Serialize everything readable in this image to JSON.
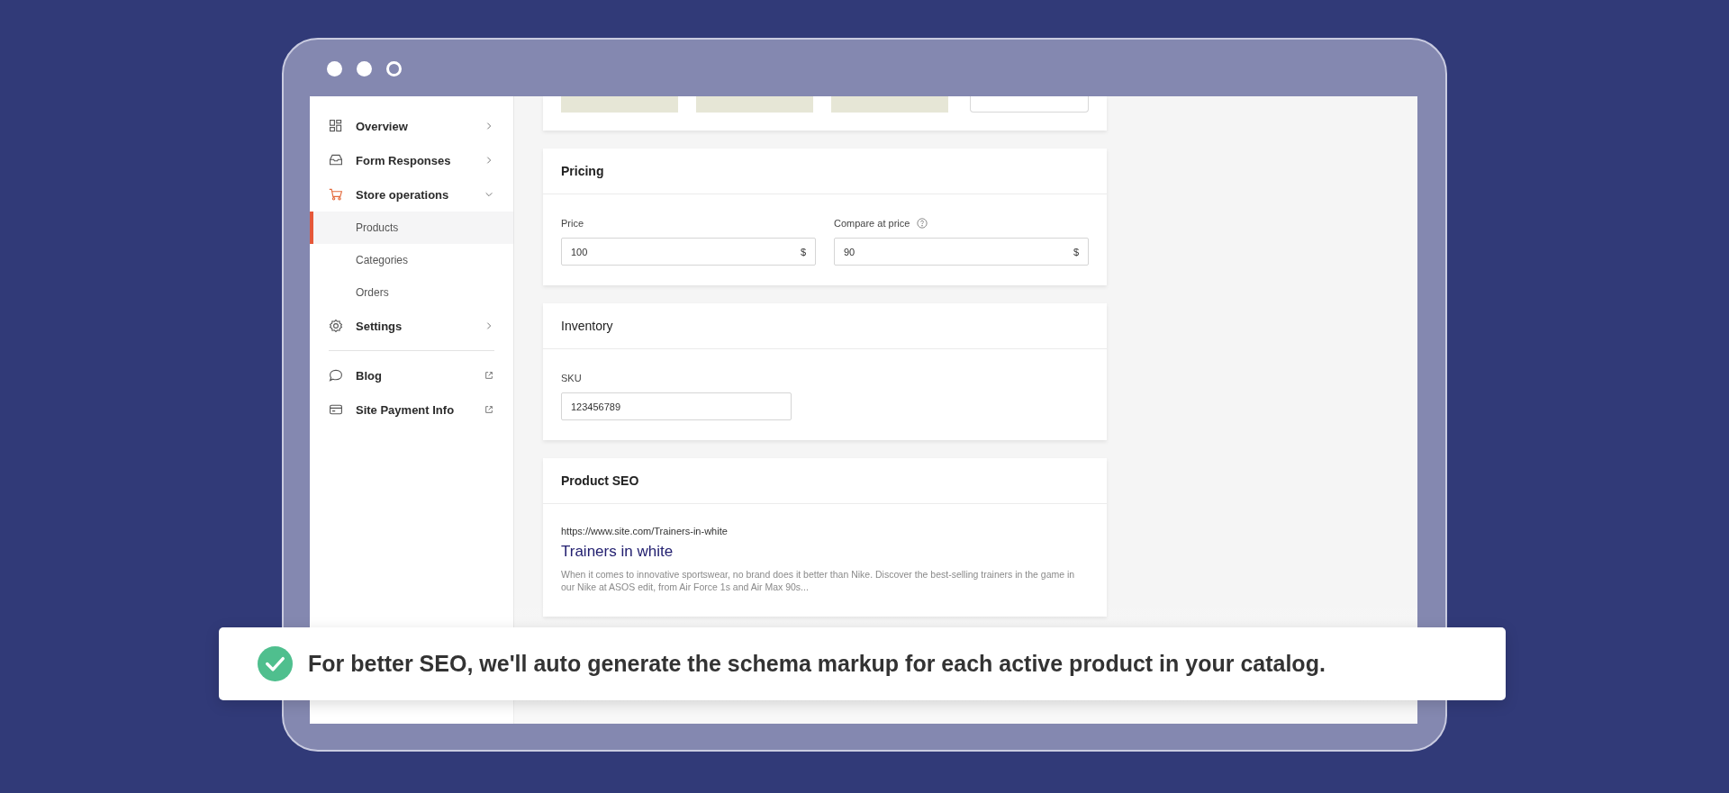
{
  "sidebar": {
    "items": [
      {
        "label": "Overview",
        "kind": "dashboard",
        "external": false,
        "expanded": false
      },
      {
        "label": "Form Responses",
        "kind": "inbox",
        "external": false,
        "expanded": false
      },
      {
        "label": "Store operations",
        "kind": "cart",
        "external": false,
        "expanded": true,
        "children": [
          {
            "label": "Products",
            "selected": true
          },
          {
            "label": "Categories",
            "selected": false
          },
          {
            "label": "Orders",
            "selected": false
          }
        ]
      },
      {
        "label": "Settings",
        "kind": "gear",
        "external": false,
        "expanded": false,
        "divider_after": true
      },
      {
        "label": "Blog",
        "kind": "chat",
        "external": true
      },
      {
        "label": "Site Payment Info",
        "kind": "card",
        "external": true
      }
    ]
  },
  "pricing": {
    "title": "Pricing",
    "fields": [
      {
        "label": "Price",
        "value": "100",
        "suffix": "$",
        "help": false
      },
      {
        "label": "Compare at price",
        "value": "90",
        "suffix": "$",
        "help": true
      }
    ]
  },
  "inventory": {
    "title": "Inventory",
    "fields": [
      {
        "label": "SKU",
        "value": "123456789"
      }
    ]
  },
  "seo": {
    "title": "Product SEO",
    "url": "https://www.site.com/Trainers-in-white",
    "link_title": "Trainers in white",
    "description": "When it comes to innovative sportswear, no brand does it better than Nike. Discover the best-selling trainers in the game in our Nike at ASOS edit, from Air Force 1s and Air Max 90s..."
  },
  "toast": {
    "text": "For better SEO, we'll auto generate the schema markup for each active product in your catalog."
  }
}
